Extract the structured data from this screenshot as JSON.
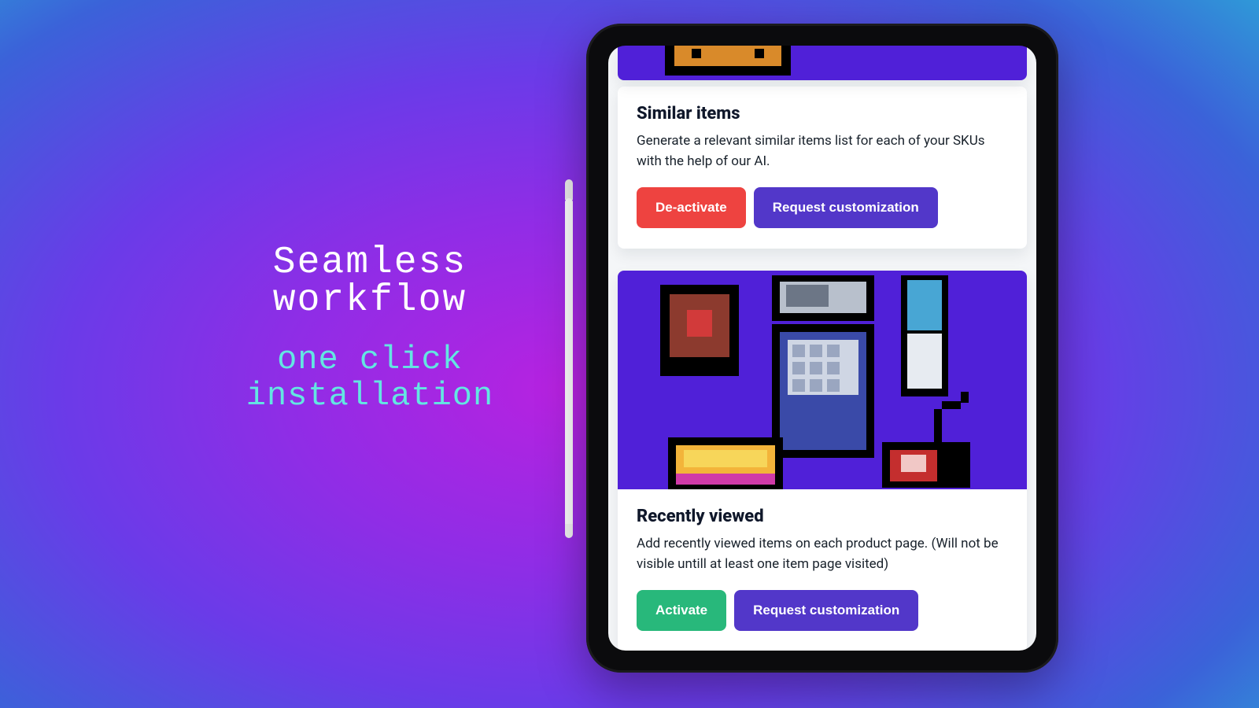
{
  "hero": {
    "headline_line1": "Seamless",
    "headline_line2": "workflow",
    "sub_line1": "one click",
    "sub_line2": "installation"
  },
  "colors": {
    "accent_purple": "#5237c9",
    "accent_red": "#ee4340",
    "accent_green": "#28b87b",
    "hero_bg": "#5020d8"
  },
  "icons": {
    "pencil": "apple-pencil-icon"
  },
  "cards": [
    {
      "id": "similar-items",
      "title": "Similar items",
      "description": "Generate a relevant similar items list for each of your SKUs with the help of our AI.",
      "buttons": [
        {
          "id": "deactivate",
          "label": "De-activate",
          "variant": "red"
        },
        {
          "id": "request-customization",
          "label": "Request customization",
          "variant": "purple"
        }
      ]
    },
    {
      "id": "recently-viewed",
      "title": "Recently viewed",
      "description": "Add recently viewed items on each product page. (Will not be visible untill at least one item page visited)",
      "buttons": [
        {
          "id": "activate",
          "label": "Activate",
          "variant": "green"
        },
        {
          "id": "request-customization",
          "label": "Request customization",
          "variant": "purple"
        }
      ]
    }
  ]
}
